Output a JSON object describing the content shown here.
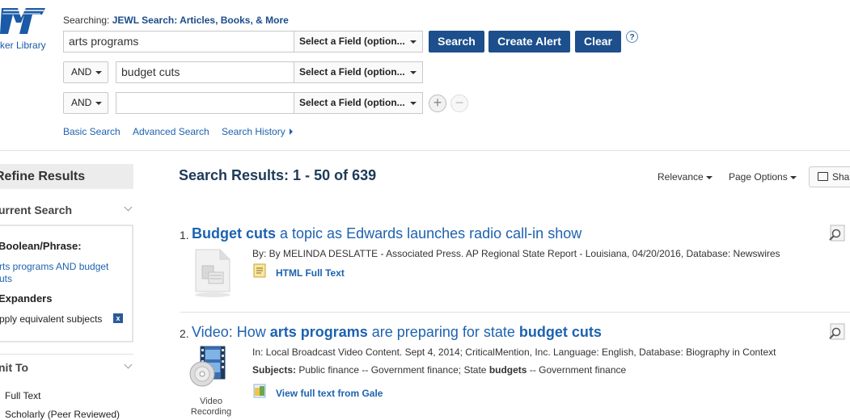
{
  "logo": {
    "text": "ker Library"
  },
  "search": {
    "searching_prefix": "Searching:",
    "searching_target": "JEWL Search: Articles, Books, & More",
    "rows": [
      {
        "bool": "",
        "value": "arts programs",
        "field": "Select a Field (option..."
      },
      {
        "bool": "AND",
        "value": "budget cuts",
        "field": "Select a Field (option..."
      },
      {
        "bool": "AND",
        "value": "",
        "field": "Select a Field (option..."
      }
    ],
    "buttons": {
      "search": "Search",
      "create_alert": "Create Alert",
      "clear": "Clear"
    },
    "help": "?",
    "add": "+",
    "remove": "−",
    "links": {
      "basic": "Basic Search",
      "advanced": "Advanced Search",
      "history": "Search History"
    }
  },
  "sidebar": {
    "refine_title": "Refine Results",
    "current_search_title": "urrent Search",
    "boolean_label": "Boolean/Phrase:",
    "boolean_value_1": "rts programs AND budget",
    "boolean_value_2": "uts",
    "expanders_label": "Expanders",
    "expander_value": "pply equivalent subjects",
    "remove_x": "x",
    "limit_title": "nit To",
    "limit_item_1": "Full Text",
    "limit_item_2": "Scholarly (Peer Reviewed)"
  },
  "results": {
    "title": "Search Results: 1 - 50 of 639",
    "relevance": "Relevance",
    "page_options": "Page Options",
    "share": "Sha",
    "items": [
      {
        "num": "1.",
        "title_bold": "Budget cuts",
        "title_rest": " a topic as Edwards launches radio call-in show",
        "meta": "By: By MELINDA DESLATTE - Associated Press. AP Regional State Report - Louisiana, 04/20/2016, Database: Newswires",
        "link": "HTML Full Text"
      },
      {
        "num": "2.",
        "title_p1": "Video: How ",
        "title_b1": "arts programs",
        "title_p2": " are preparing for state ",
        "title_b2": "budget cuts",
        "meta": "In: Local Broadcast Video Content. Sept 4, 2014; CriticalMention, Inc. Language: English, Database: Biography in Context",
        "subjects_label": "Subjects:",
        "subjects_p1": " Public finance -- Government finance; State ",
        "subjects_b": "budgets",
        "subjects_p2": " -- Government finance",
        "type_line1": "Video",
        "type_line2": "Recording",
        "link": "View full text from Gale"
      }
    ]
  }
}
